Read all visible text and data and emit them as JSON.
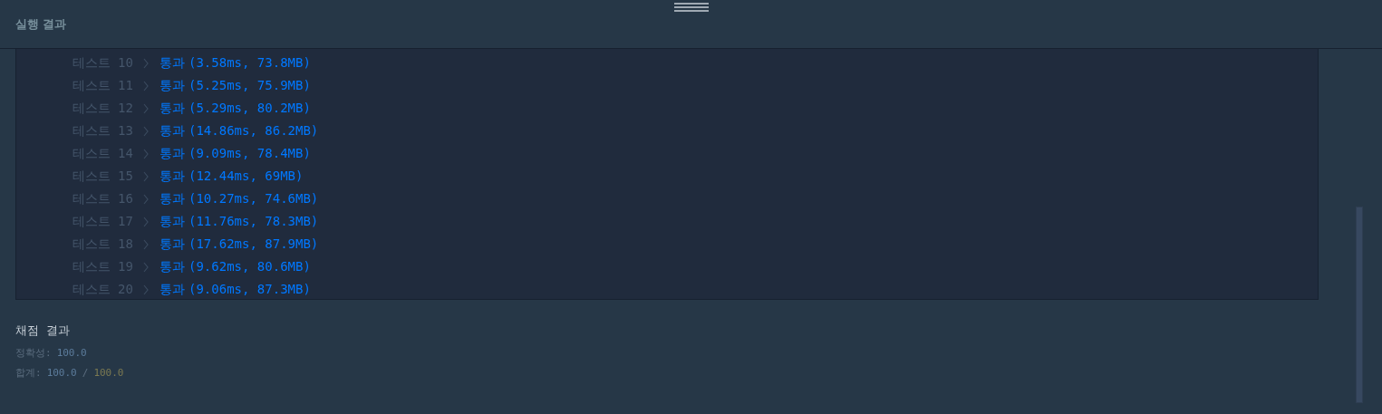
{
  "header": {
    "title": "실행 결과"
  },
  "tests": [
    {
      "label": "테스트",
      "number": "10",
      "result": "통과",
      "detail": "(3.58ms, 73.8MB)"
    },
    {
      "label": "테스트",
      "number": "11",
      "result": "통과",
      "detail": "(5.25ms, 75.9MB)"
    },
    {
      "label": "테스트",
      "number": "12",
      "result": "통과",
      "detail": "(5.29ms, 80.2MB)"
    },
    {
      "label": "테스트",
      "number": "13",
      "result": "통과",
      "detail": "(14.86ms, 86.2MB)"
    },
    {
      "label": "테스트",
      "number": "14",
      "result": "통과",
      "detail": "(9.09ms, 78.4MB)"
    },
    {
      "label": "테스트",
      "number": "15",
      "result": "통과",
      "detail": "(12.44ms, 69MB)"
    },
    {
      "label": "테스트",
      "number": "16",
      "result": "통과",
      "detail": "(10.27ms, 74.6MB)"
    },
    {
      "label": "테스트",
      "number": "17",
      "result": "통과",
      "detail": "(11.76ms, 78.3MB)"
    },
    {
      "label": "테스트",
      "number": "18",
      "result": "통과",
      "detail": "(17.62ms, 87.9MB)"
    },
    {
      "label": "테스트",
      "number": "19",
      "result": "통과",
      "detail": "(9.62ms, 80.6MB)"
    },
    {
      "label": "테스트",
      "number": "20",
      "result": "통과",
      "detail": "(9.06ms, 87.3MB)"
    }
  ],
  "grading": {
    "title": "채점 결과",
    "accuracy_label": "정확성:",
    "accuracy_value": "100.0",
    "total_label": "합계:",
    "total_score": "100.0",
    "total_separator": "/",
    "total_max": "100.0"
  }
}
